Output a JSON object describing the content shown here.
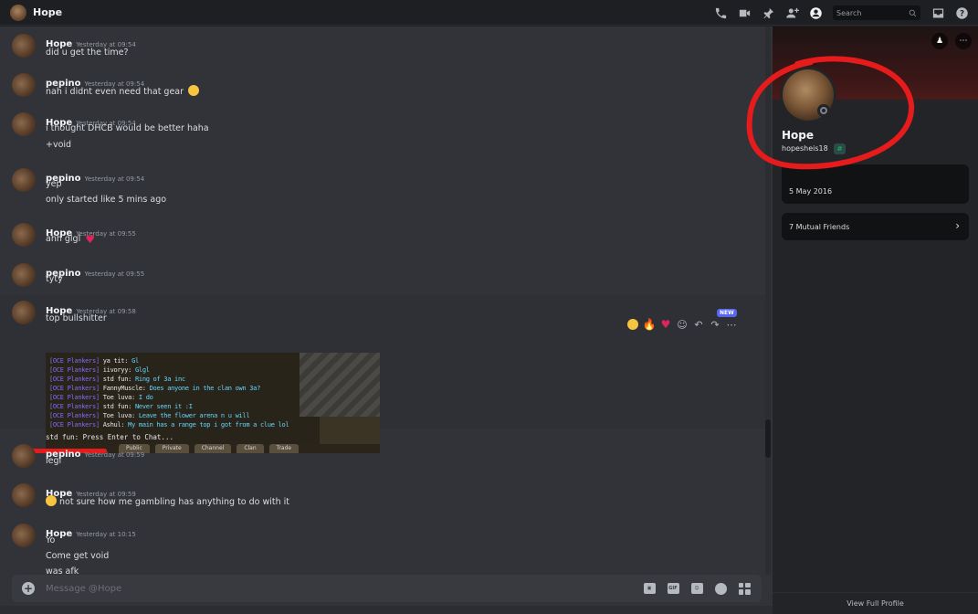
{
  "topbar": {
    "title": "Hope",
    "search_placeholder": "Search",
    "icons": [
      "phone-icon",
      "video-icon",
      "pin-icon",
      "add-friends-icon",
      "profile-toggle-icon",
      "inbox-icon",
      "help-icon"
    ]
  },
  "messages": [
    {
      "author": "Hope",
      "time": "Yesterday at 09:54",
      "lines": [
        "did u get the time?"
      ]
    },
    {
      "author": "pepino",
      "time": "Yesterday at 09:54",
      "lines": [
        "nah i didnt even need that gear"
      ]
    },
    {
      "author": "Hope",
      "time": "Yesterday at 09:54",
      "lines": [
        "i thought DHCB would be better haha",
        "+void"
      ]
    },
    {
      "author": "pepino",
      "time": "Yesterday at 09:54",
      "lines": [
        "yep",
        "only started like 5 mins ago"
      ]
    },
    {
      "author": "Hope",
      "time": "Yesterday at 09:55",
      "lines": [
        "ahh glgl"
      ]
    },
    {
      "author": "pepino",
      "time": "Yesterday at 09:55",
      "lines": [
        "tyty"
      ]
    },
    {
      "author": "Hope",
      "time": "Yesterday at 09:58",
      "lines": [
        "top bullshitter"
      ]
    },
    {
      "author": "pepino",
      "time": "Yesterday at 09:59",
      "lines": [
        "legi"
      ]
    },
    {
      "author": "Hope",
      "time": "Yesterday at 09:59",
      "lines": [
        "not sure how me gambling has anything to do with it"
      ]
    },
    {
      "author": "Hope",
      "time": "Yesterday at 10:15",
      "lines": [
        "Yo",
        "Come get void",
        "was afk"
      ]
    }
  ],
  "hover_actions": {
    "new_badge": "NEW",
    "icons": [
      "laugh-reaction-icon",
      "fire-reaction-icon",
      "heart-reaction-icon",
      "add-reaction-icon",
      "reply-icon",
      "forward-icon",
      "more-icon"
    ]
  },
  "game_chat": {
    "clan_tag": "[OCE Plankers]",
    "lines": [
      {
        "who": "ya tit:",
        "text": "Gl"
      },
      {
        "who": "iivoryy:",
        "text": "Glgl"
      },
      {
        "who": "std fun:",
        "text": "Ring of 3a inc"
      },
      {
        "who": "FannyMuscle:",
        "text": "Does anyone in the clan own 3a?"
      },
      {
        "who": "Toe luva:",
        "text": "I do"
      },
      {
        "who": "std fun:",
        "text": "Never seen it :I"
      },
      {
        "who": "Toe luva:",
        "text": "Leave the flower arena n u will"
      },
      {
        "who": "Ashul:",
        "text": "My main has a range top i got from a clue lol"
      }
    ],
    "prompt": "std fun: Press Enter to Chat...",
    "tabs": [
      "Public",
      "Private",
      "Channel",
      "Clan",
      "Trade"
    ]
  },
  "composer": {
    "placeholder": "Message @Hope",
    "gif_label": "GIF"
  },
  "profile": {
    "display_name": "Hope",
    "username": "hopesheis18",
    "badge": "#",
    "member_since": "5 May 2016",
    "mutual_friends": "7 Mutual Friends",
    "view_full_profile": "View Full Profile"
  },
  "colors": {
    "background": "#313338",
    "sidebar": "#232428",
    "accent": "#5865f2",
    "annotation_red": "#e61b1b"
  }
}
